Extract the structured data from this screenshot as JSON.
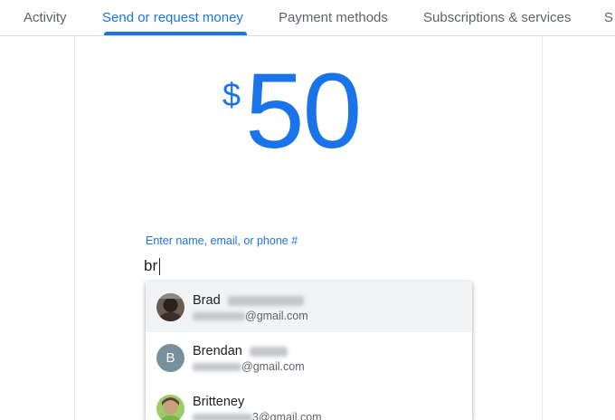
{
  "tabs": [
    {
      "label": "Activity"
    },
    {
      "label": "Send or request money",
      "active": true
    },
    {
      "label": "Payment methods"
    },
    {
      "label": "Subscriptions & services"
    },
    {
      "label": "S"
    }
  ],
  "amount": {
    "currency": "$",
    "value": "50"
  },
  "recipient": {
    "label": "Enter name, email, or phone #",
    "value": "br"
  },
  "suggestions": [
    {
      "name": "Brad",
      "email_domain": "@gmail.com",
      "avatar": "photo"
    },
    {
      "name": "Brendan",
      "email_domain": "@gmail.com",
      "avatar": "B"
    },
    {
      "name": "Britteney",
      "email_domain": "3@gmail.com",
      "avatar": "photo"
    }
  ],
  "colors": {
    "accent": "#1a73e8",
    "text": "#202124",
    "secondary": "#5f6368",
    "highlight": "#f1f3f4",
    "avatar_bg": "#78909c"
  }
}
